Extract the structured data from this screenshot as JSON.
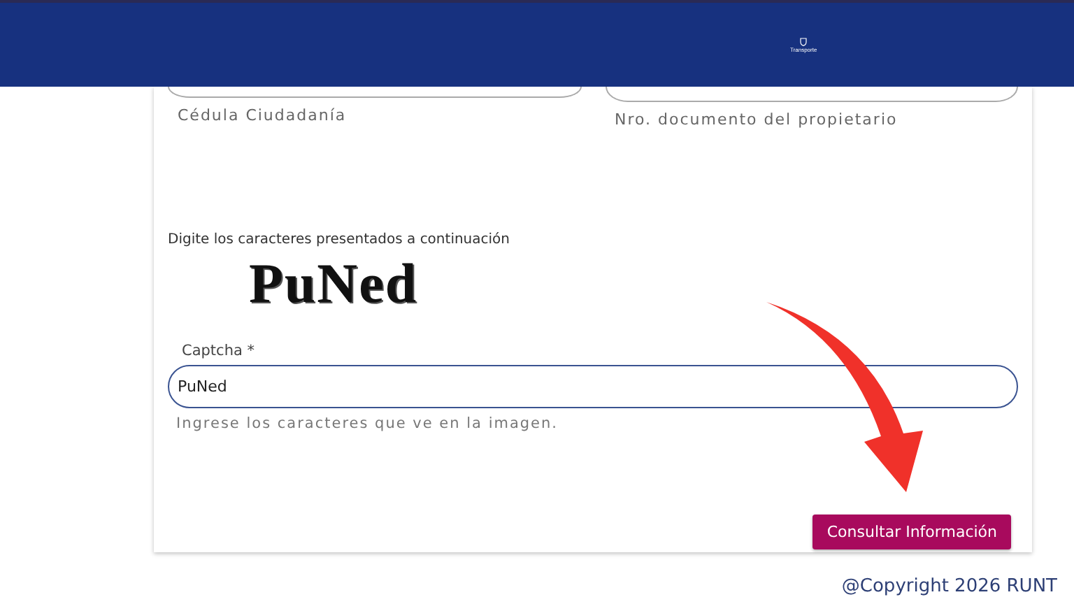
{
  "header": {
    "logo_text": "Transporte"
  },
  "fields": [
    {
      "helper": "Cédula Ciudadanía"
    },
    {
      "helper": "Nro. documento del propietario"
    }
  ],
  "captcha": {
    "instruction": "Digite los caracteres presentados a continuación",
    "image_text": "PuNed",
    "label": "Captcha *",
    "value": "PuNed",
    "hint": "Ingrese los caracteres que ve en la imagen."
  },
  "submit_button": "Consultar Información",
  "footer": "@Copyright 2026 RUNT"
}
